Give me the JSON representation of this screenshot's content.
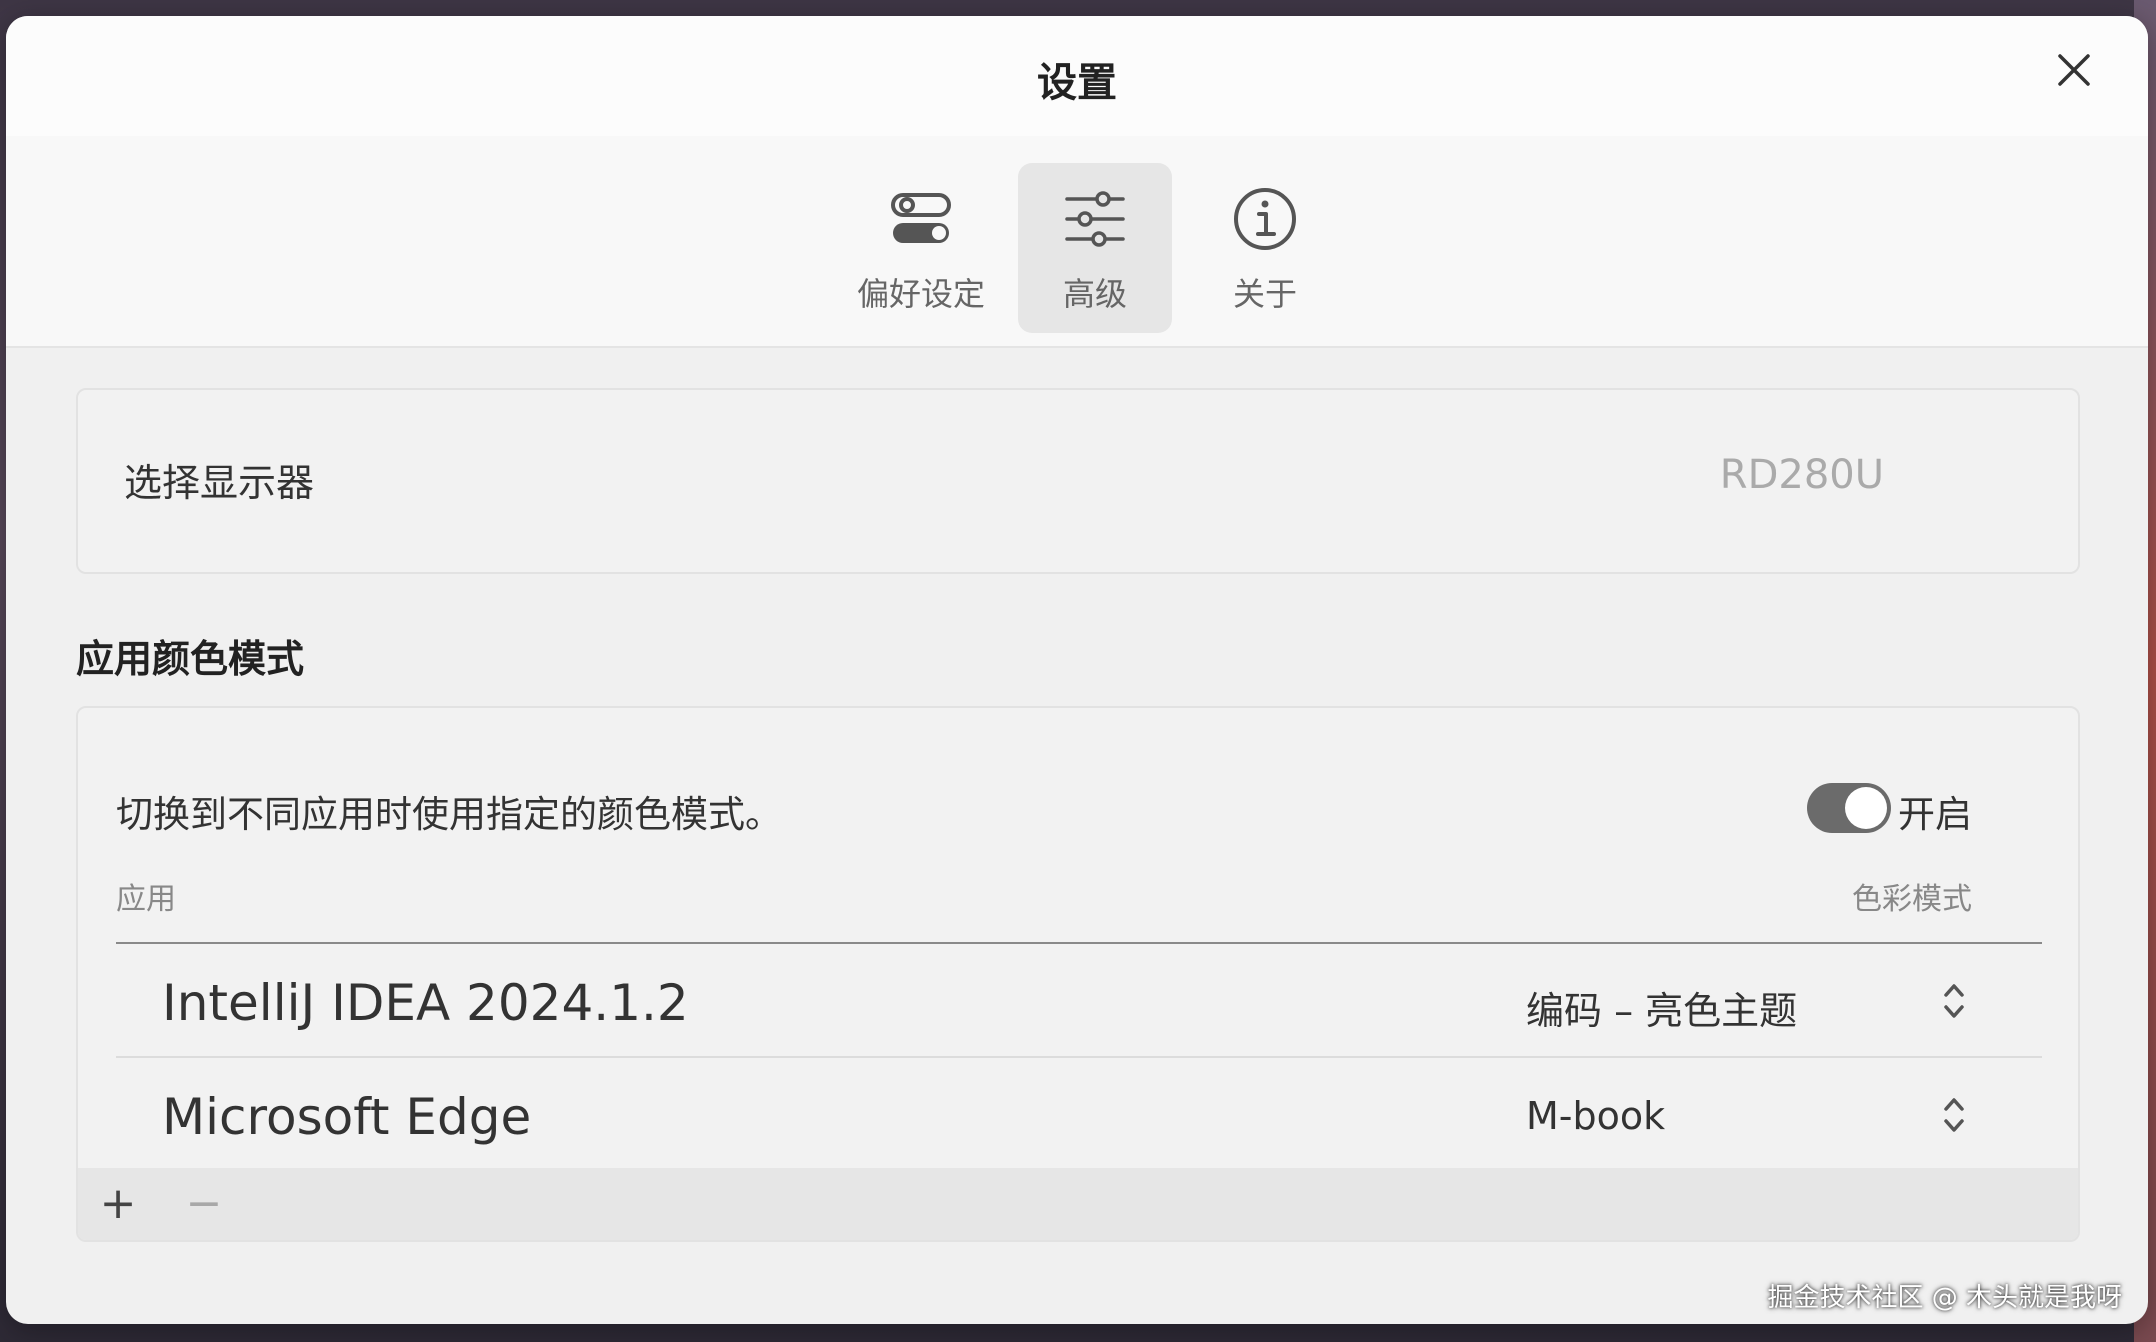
{
  "window": {
    "title": "设置",
    "close_icon": "close-icon"
  },
  "toolbar": {
    "tabs": [
      {
        "label": "偏好设定",
        "icon": "toggles-icon",
        "active": false
      },
      {
        "label": "高级",
        "icon": "sliders-icon",
        "active": true
      },
      {
        "label": "关于",
        "icon": "info-icon",
        "active": false
      }
    ]
  },
  "display": {
    "label": "选择显示器",
    "value": "RD280U"
  },
  "app_color_mode": {
    "section_title": "应用颜色模式",
    "description": "切换到不同应用时使用指定的颜色模式。",
    "toggle": {
      "label": "开启",
      "on": true
    },
    "columns": {
      "app": "应用",
      "mode": "色彩模式"
    },
    "rows": [
      {
        "app": "IntelliJ IDEA 2024.1.2",
        "mode": "编码 – 亮色主题"
      },
      {
        "app": "Microsoft Edge",
        "mode": "M-book"
      }
    ],
    "add_label": "+",
    "remove_label": "−"
  },
  "watermark": "掘金技术社区 @ 木头就是我呀",
  "colors": {
    "window_bg": "#f0f0f0",
    "active_tab_bg": "#e6e6e6",
    "toggle_on": "#6b6b6b",
    "muted_text": "#aaaaaa"
  }
}
